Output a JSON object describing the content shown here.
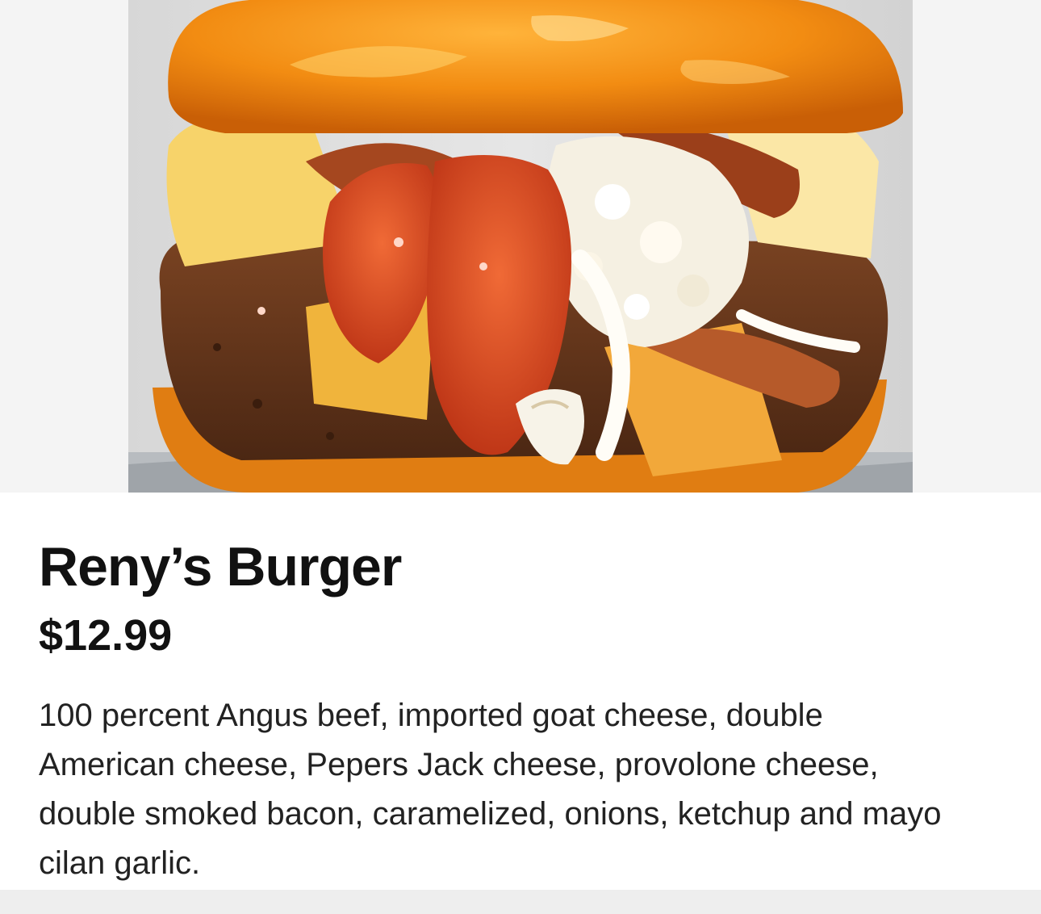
{
  "product": {
    "image_subject": "burger-photo",
    "name": "Reny’s Burger",
    "price": "$12.99",
    "description": "100 percent Angus beef, imported goat cheese, double American cheese, Pepers Jack cheese, provolone cheese, double smoked bacon, caramelized, onions, ketchup and mayo cilan garlic."
  },
  "colors": {
    "page_background": "#ffffff",
    "image_background": "#f4f4f4",
    "bun": "#f08a16",
    "ketchup": "#d9471a",
    "cheese": "#f5c14b",
    "text": "#111111",
    "bottom_bar": "#eeeeee"
  }
}
